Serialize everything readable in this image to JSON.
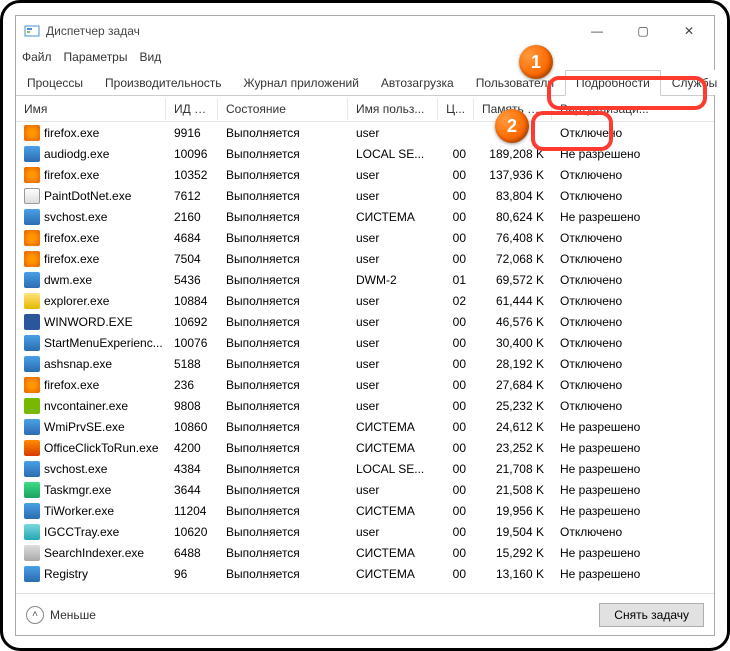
{
  "window": {
    "title": "Диспетчер задач",
    "menu": {
      "file": "Файл",
      "options": "Параметры",
      "view": "Вид"
    },
    "controls": {
      "min": "—",
      "max": "▢",
      "close": "✕"
    }
  },
  "tabs": {
    "processes": "Процессы",
    "performance": "Производительность",
    "app_history": "Журнал приложений",
    "startup": "Автозагрузка",
    "users": "Пользователи",
    "details": "Подробности",
    "services": "Службы"
  },
  "columns": {
    "name": "Имя",
    "pid": "ИД п...",
    "status": "Состояние",
    "user": "Имя польз...",
    "cpu": "Ц...",
    "memory": "Память (а...",
    "virtualization": "Виртуализаци..."
  },
  "statuses": {
    "running": "Выполняется"
  },
  "virt": {
    "disabled": "Отключено",
    "not_allowed": "Не разрешено"
  },
  "rows": [
    {
      "icon": "ic-ff",
      "name": "firefox.exe",
      "pid": "9916",
      "user": "user",
      "cpu": "",
      "mem": "",
      "virt": "Отключено"
    },
    {
      "icon": "ic-blue",
      "name": "audiodg.exe",
      "pid": "10096",
      "user": "LOCAL SE...",
      "cpu": "00",
      "mem": "189,208 K",
      "virt": "Не разрешено"
    },
    {
      "icon": "ic-ff",
      "name": "firefox.exe",
      "pid": "10352",
      "user": "user",
      "cpu": "00",
      "mem": "137,936 K",
      "virt": "Отключено"
    },
    {
      "icon": "ic-paint",
      "name": "PaintDotNet.exe",
      "pid": "7612",
      "user": "user",
      "cpu": "00",
      "mem": "83,804 K",
      "virt": "Отключено"
    },
    {
      "icon": "ic-blue",
      "name": "svchost.exe",
      "pid": "2160",
      "user": "СИСТЕМА",
      "cpu": "00",
      "mem": "80,624 K",
      "virt": "Не разрешено"
    },
    {
      "icon": "ic-ff",
      "name": "firefox.exe",
      "pid": "4684",
      "user": "user",
      "cpu": "00",
      "mem": "76,408 K",
      "virt": "Отключено"
    },
    {
      "icon": "ic-ff",
      "name": "firefox.exe",
      "pid": "7504",
      "user": "user",
      "cpu": "00",
      "mem": "72,068 K",
      "virt": "Отключено"
    },
    {
      "icon": "ic-blue",
      "name": "dwm.exe",
      "pid": "5436",
      "user": "DWM-2",
      "cpu": "01",
      "mem": "69,572 K",
      "virt": "Отключено"
    },
    {
      "icon": "ic-yellow",
      "name": "explorer.exe",
      "pid": "10884",
      "user": "user",
      "cpu": "02",
      "mem": "61,444 K",
      "virt": "Отключено"
    },
    {
      "icon": "ic-word",
      "name": "WINWORD.EXE",
      "pid": "10692",
      "user": "user",
      "cpu": "00",
      "mem": "46,576 K",
      "virt": "Отключено"
    },
    {
      "icon": "ic-blue",
      "name": "StartMenuExperienc...",
      "pid": "10076",
      "user": "user",
      "cpu": "00",
      "mem": "30,400 K",
      "virt": "Отключено"
    },
    {
      "icon": "ic-blue",
      "name": "ashsnap.exe",
      "pid": "5188",
      "user": "user",
      "cpu": "00",
      "mem": "28,192 K",
      "virt": "Отключено"
    },
    {
      "icon": "ic-ff",
      "name": "firefox.exe",
      "pid": "236",
      "user": "user",
      "cpu": "00",
      "mem": "27,684 K",
      "virt": "Отключено"
    },
    {
      "icon": "ic-nv",
      "name": "nvcontainer.exe",
      "pid": "9808",
      "user": "user",
      "cpu": "00",
      "mem": "25,232 K",
      "virt": "Отключено"
    },
    {
      "icon": "ic-blue",
      "name": "WmiPrvSE.exe",
      "pid": "10860",
      "user": "СИСТЕМА",
      "cpu": "00",
      "mem": "24,612 K",
      "virt": "Не разрешено"
    },
    {
      "icon": "ic-office",
      "name": "OfficeClickToRun.exe",
      "pid": "4200",
      "user": "СИСТЕМА",
      "cpu": "00",
      "mem": "23,252 K",
      "virt": "Не разрешено"
    },
    {
      "icon": "ic-blue",
      "name": "svchost.exe",
      "pid": "4384",
      "user": "LOCAL SE...",
      "cpu": "00",
      "mem": "21,708 K",
      "virt": "Не разрешено"
    },
    {
      "icon": "ic-green",
      "name": "Taskmgr.exe",
      "pid": "3644",
      "user": "user",
      "cpu": "00",
      "mem": "21,508 K",
      "virt": "Не разрешено"
    },
    {
      "icon": "ic-blue",
      "name": "TiWorker.exe",
      "pid": "11204",
      "user": "СИСТЕМА",
      "cpu": "00",
      "mem": "19,956 K",
      "virt": "Не разрешено"
    },
    {
      "icon": "ic-cyan",
      "name": "IGCCTray.exe",
      "pid": "10620",
      "user": "user",
      "cpu": "00",
      "mem": "19,504 K",
      "virt": "Отключено"
    },
    {
      "icon": "ic-gray",
      "name": "SearchIndexer.exe",
      "pid": "6488",
      "user": "СИСТЕМА",
      "cpu": "00",
      "mem": "15,292 K",
      "virt": "Не разрешено"
    },
    {
      "icon": "ic-blue",
      "name": "Registry",
      "pid": "96",
      "user": "СИСТЕМА",
      "cpu": "00",
      "mem": "13,160 K",
      "virt": "Не разрешено"
    }
  ],
  "footer": {
    "fewer": "Меньше",
    "end_task": "Снять задачу"
  },
  "annotations": {
    "badge1": "1",
    "badge2": "2"
  }
}
